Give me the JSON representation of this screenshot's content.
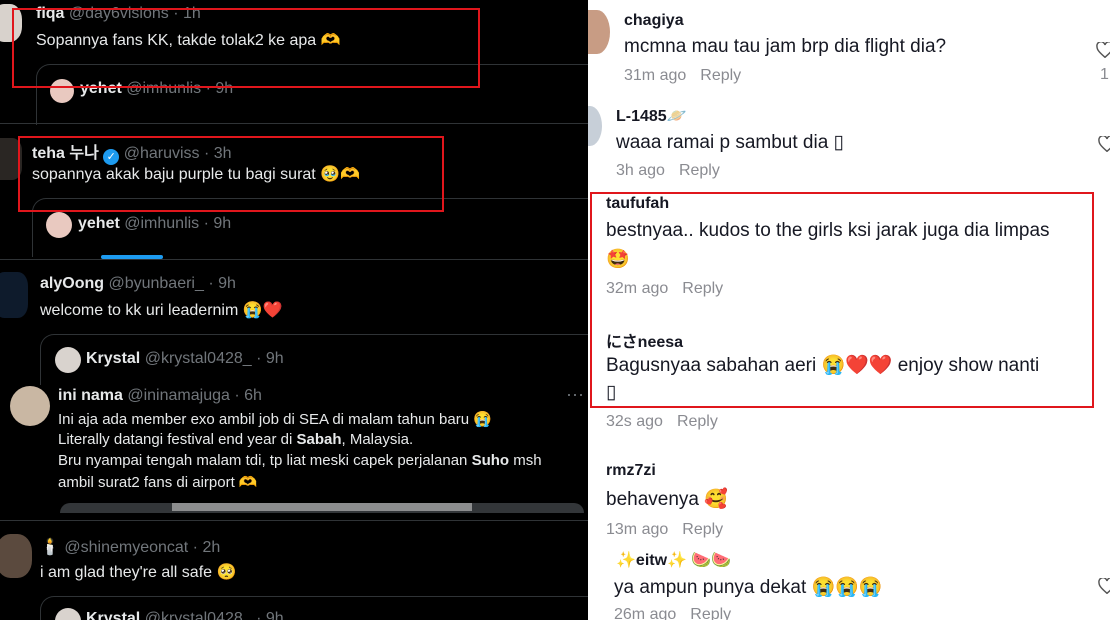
{
  "left": {
    "tweets": [
      {
        "name": "fiqa",
        "handle": "@day6visions · 1h",
        "text": "Sopannya fans KK, takde tolak2 ke apa 🫶",
        "quote": {
          "name": "yehet",
          "handle": "@imhunlis · 9h"
        }
      },
      {
        "name": "teha 누나",
        "handle": "@haruviss · 3h",
        "text": "sopannya akak baju purple tu bagi surat 🥹🫶",
        "quote": {
          "name": "yehet",
          "handle": "@imhunlis · 9h"
        }
      },
      {
        "name": "alyOong",
        "handle": "@byunbaeri_ · 9h",
        "text": "welcome to kk uri leadernim 😭❤️",
        "quote": {
          "name": "Krystal",
          "handle": "@krystal0428_ · 9h"
        }
      },
      {
        "name": "ini nama",
        "handle": "@ininamajuga · 6h",
        "lines": [
          "Ini aja ada member exo ambil job di SEA di malam tahun baru 😭",
          "Literally datangi festival end year di ",
          "Sabah",
          ", Malaysia.",
          "Bru nyampai tengah malam tdi, tp liat meski capek perjalanan ",
          "Suho",
          " msh",
          "ambil surat2 fans di airport 🫶"
        ],
        "more": "···"
      },
      {
        "name": "",
        "handle": "@shinemyeoncat · 2h",
        "emoji_prefix": "🕯️",
        "text": "i am glad they're all safe 🥺",
        "quote": {
          "name": "Krystal",
          "handle": "@krystal0428_ · 9h"
        }
      }
    ]
  },
  "right": {
    "comments": [
      {
        "name": "chagiya",
        "text": "mcmna mau tau jam brp dia flight dia?",
        "time": "31m ago",
        "reply": "Reply",
        "likes": "1"
      },
      {
        "name": "L-1485🪐",
        "text": "waaa ramai p sambut dia ▯",
        "time": "3h ago",
        "reply": "Reply"
      },
      {
        "name": "taufufah",
        "text": "bestnyaa.. kudos to the girls ksi jarak juga dia limpas",
        "text2": "🤩",
        "time": "32m ago",
        "reply": "Reply"
      },
      {
        "name": "にさneesa",
        "text": "Bagusnyaa sabahan aeri 😭❤️❤️ enjoy show nanti",
        "text2": "▯",
        "time": "32s ago",
        "reply": "Reply"
      },
      {
        "name": "rmz7zi",
        "text": "behavenya 🥰",
        "time": "13m ago",
        "reply": "Reply"
      },
      {
        "name": "✨eitw✨ 🍉🍉",
        "text": "ya ampun punya dekat 😭😭😭",
        "time": "26m ago",
        "reply": "Reply"
      }
    ]
  },
  "colors": {
    "highlight": "#e0161c",
    "twitter_blue": "#1d9bf0"
  }
}
